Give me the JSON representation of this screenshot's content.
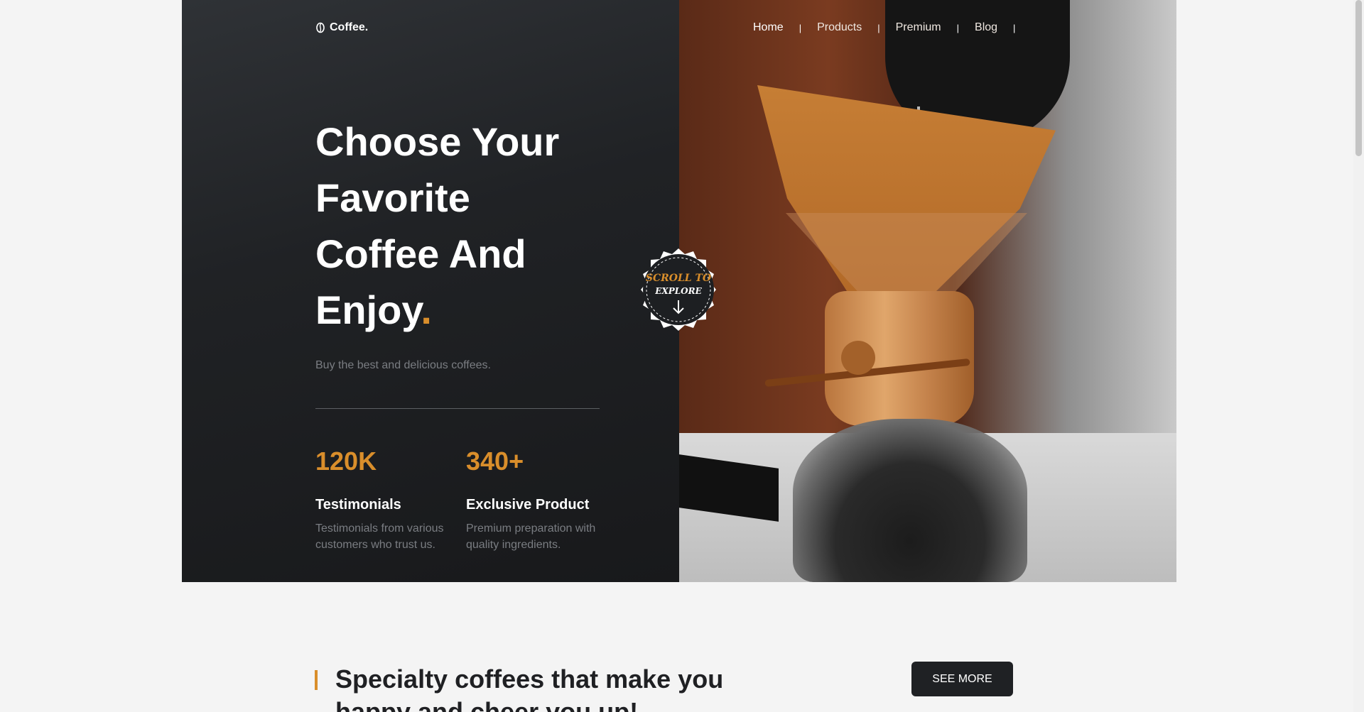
{
  "brand": {
    "name": "Coffee.",
    "icon": "coffee-bean-icon"
  },
  "nav": {
    "items": [
      {
        "label": "Home",
        "active": true
      },
      {
        "label": "Products",
        "active": false
      },
      {
        "label": "Premium",
        "active": false
      },
      {
        "label": "Blog",
        "active": false
      }
    ],
    "separator": "|"
  },
  "hero": {
    "headline": {
      "line1": "Choose Your",
      "line2": "Favorite",
      "line3": "Coffee And",
      "line4": "Enjoy",
      "accent": "."
    },
    "subtitle": "Buy the best and delicious coffees.",
    "stats": [
      {
        "value": "120K",
        "title": "Testimonials",
        "desc_line1": "Testimonials from various",
        "desc_line2": "customers who trust us."
      },
      {
        "value": "340+",
        "title": "Exclusive Product",
        "desc_line1": "Premium preparation with",
        "desc_line2": "quality ingredients."
      }
    ],
    "badge": {
      "line1": "SCROLL TO",
      "line2": "EXPLORE",
      "icon": "arrow-down-icon"
    }
  },
  "section": {
    "title_line1": "Specialty coffees that make you",
    "title_line2": "happy and cheer you up!",
    "cta": "SEE MORE"
  },
  "colors": {
    "accent": "#d98e2b",
    "dark": "#1f2124",
    "page_bg": "#f4f4f4"
  }
}
